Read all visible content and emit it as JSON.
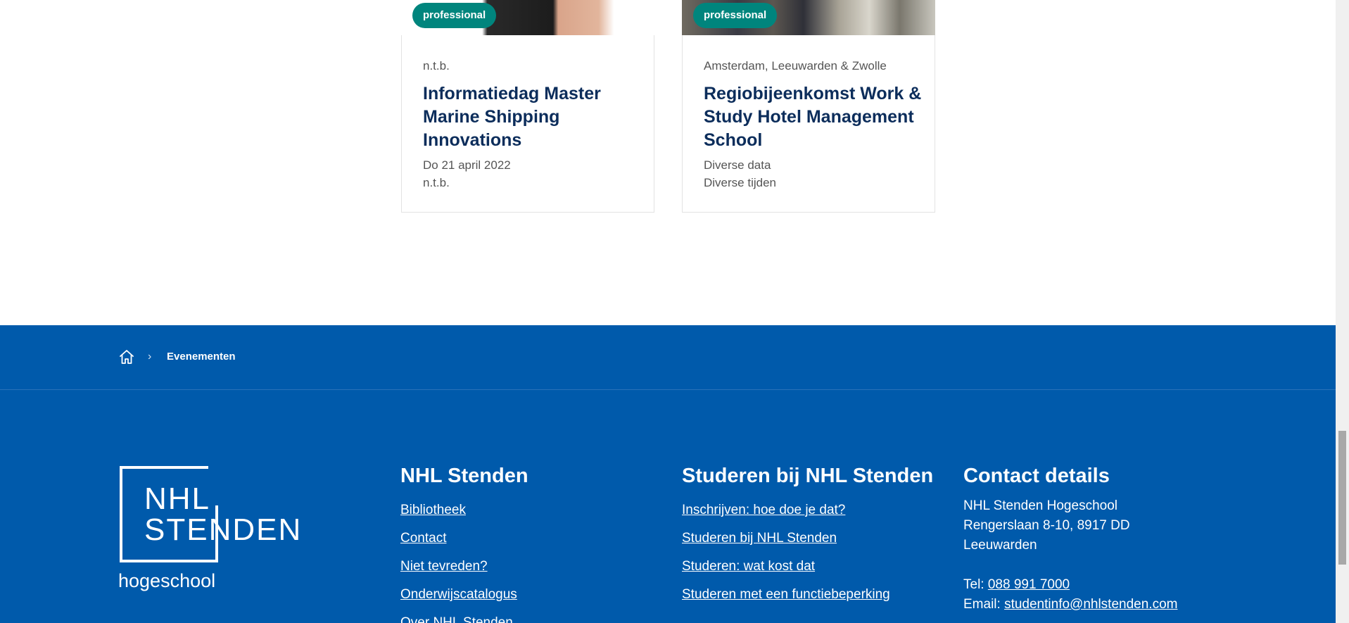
{
  "cards": [
    {
      "badge": "professional",
      "location": "n.t.b.",
      "title": "Informatiedag Master Marine Shipping Innovations",
      "date": "Do 21 april 2022",
      "time": "n.t.b."
    },
    {
      "badge": "professional",
      "location": "Amsterdam, Leeuwarden & Zwolle",
      "title": "Regiobijeenkomst Work & Study Hotel Management School",
      "date": "Diverse data",
      "time": "Diverse tijden"
    }
  ],
  "breadcrumb": {
    "home_icon": "home-icon",
    "separator": "›",
    "current": "Evenementen"
  },
  "logo": {
    "line1": "NHL",
    "line2": "STENDEN",
    "subtitle": "hogeschool"
  },
  "footer": {
    "col1": {
      "heading": "NHL Stenden",
      "links": [
        "Bibliotheek",
        "Contact",
        "Niet tevreden?",
        "Onderwijscatalogus",
        "Over NHL Stenden"
      ]
    },
    "col2": {
      "heading": "Studeren bij NHL Stenden",
      "links": [
        "Inschrijven: hoe doe je dat?",
        "Studeren bij NHL Stenden",
        "Studeren: wat kost dat",
        "Studeren met een functiebeperking"
      ]
    },
    "col3": {
      "heading": "Contact details",
      "address_line1": "NHL Stenden Hogeschool",
      "address_line2": "Rengerslaan 8-10, 8917 DD",
      "address_line3": "Leeuwarden",
      "tel_label": "Tel:",
      "tel_value": "088 991 7000",
      "email_label": "Email:",
      "email_value": "studentinfo@nhlstenden.com"
    }
  },
  "colors": {
    "footer_bg": "#005aab",
    "badge_bg": "#00857d",
    "title_color": "#0c2d5b"
  }
}
